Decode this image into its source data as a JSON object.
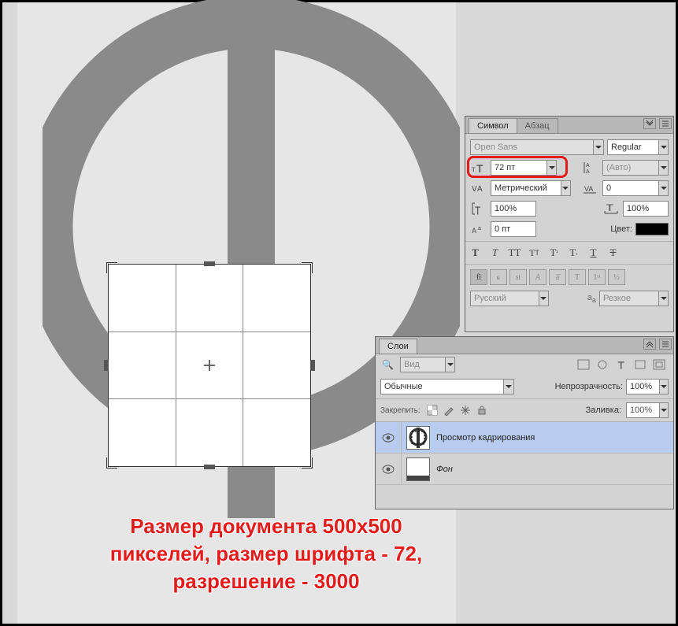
{
  "canvas_glyph": "Ф",
  "panels": {
    "character": {
      "tabs": {
        "active": "Символ",
        "inactive": "Абзац"
      },
      "font_family": "Open Sans",
      "font_style": "Regular",
      "font_size": "72 пт",
      "leading": "(Авто)",
      "kerning": "Метрический",
      "tracking": "0",
      "hscale": "100%",
      "vscale": "100%",
      "baseline": "0 пт",
      "color_label": "Цвет:",
      "type_buttons": [
        "T",
        "T",
        "TT",
        "Tт",
        "T",
        "T",
        "T",
        "Ŧ"
      ],
      "opentype_buttons": [
        "fi",
        "σ",
        "st",
        "A",
        "ā",
        "T",
        "1ˢᵗ",
        "½"
      ],
      "language": "Русский",
      "aa_mode": "Резкое"
    },
    "layers": {
      "title": "Слои",
      "search_placeholder": "Вид",
      "blend_mode": "Обычные",
      "opacity_label": "Непрозрачность:",
      "opacity_value": "100%",
      "lock_label": "Закрепить:",
      "fill_label": "Заливка:",
      "fill_value": "100%",
      "items": [
        {
          "name": "Просмотр кадрирования",
          "thumb_glyph": "Ф",
          "selected": true
        },
        {
          "name": "Фон",
          "thumb_glyph": "",
          "selected": false
        }
      ]
    }
  },
  "annotation": {
    "line1": "Размер документа 500х500",
    "line2": "пикселей, размер шрифта - 72,",
    "line3": "разрешение  - 3000"
  }
}
